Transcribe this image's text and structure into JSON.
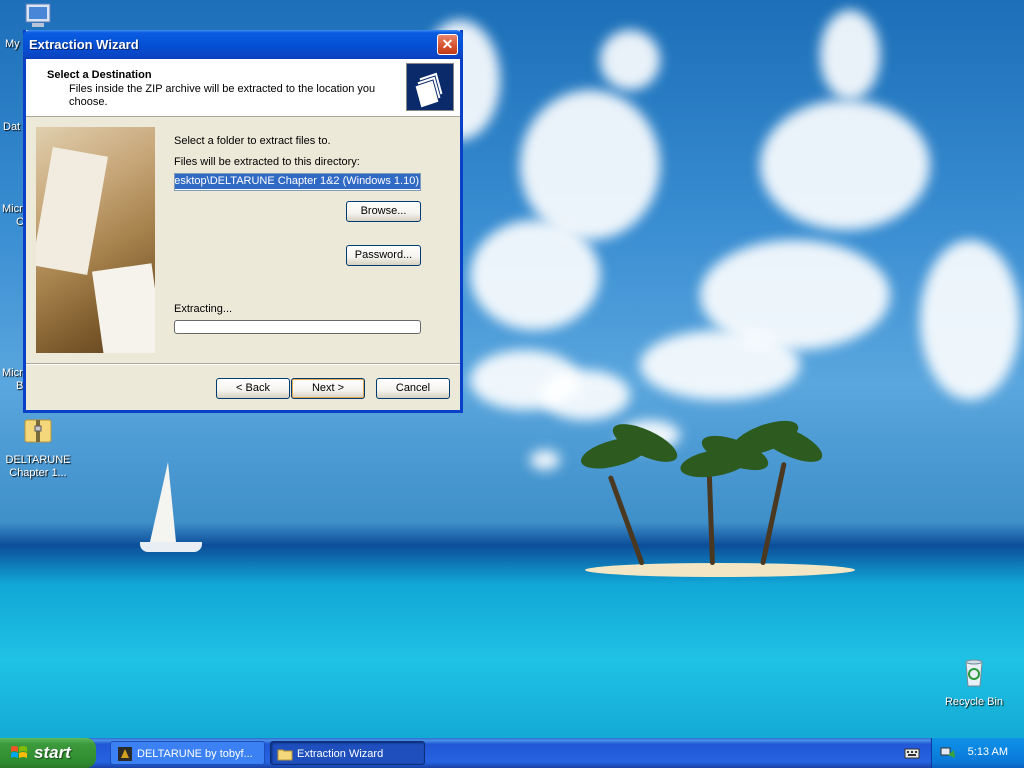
{
  "window": {
    "title": "Extraction Wizard",
    "close_label": "✕",
    "header_title": "Select a Destination",
    "header_subtitle": "Files inside the ZIP archive will be extracted to the location you choose.",
    "instruction": "Select a folder to extract files to.",
    "directory_label": "Files will be extracted to this directory:",
    "directory_value": "esktop\\DELTARUNE Chapter 1&2 (Windows 1.10)",
    "browse_label": "Browse...",
    "password_label": "Password...",
    "status_label": "Extracting...",
    "progress_percent": 0,
    "back_label": "< Back",
    "next_label": "Next >",
    "cancel_label": "Cancel"
  },
  "desktop": {
    "icons": [
      {
        "label": "DELTARUNE Chapter 1...",
        "icon": "zip-folder-icon"
      },
      {
        "label": "Recycle Bin",
        "icon": "recycle-bin-icon"
      }
    ],
    "clipped_labels": [
      "My",
      "Dat",
      "Micr",
      "C",
      "Micr",
      "B"
    ]
  },
  "taskbar": {
    "start_label": "start",
    "tasks": [
      {
        "label": "DELTARUNE by tobyf...",
        "icon": "deltarune-icon",
        "active": false
      },
      {
        "label": "Extraction Wizard",
        "icon": "folder-icon",
        "active": true
      }
    ],
    "clock": "5:13 AM"
  },
  "colors": {
    "title_blue": "#0551d6",
    "progress_green": "#2ebd2e",
    "selection_blue": "#316ac5"
  }
}
